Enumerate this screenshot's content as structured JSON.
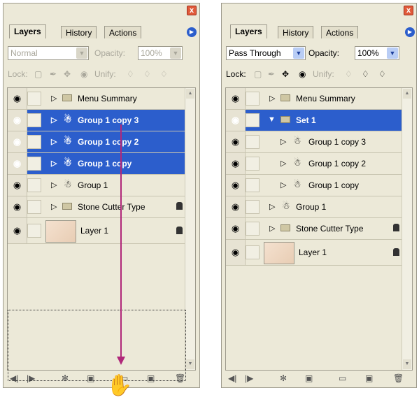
{
  "left_panel": {
    "tabs": [
      "Layers",
      "History",
      "Actions"
    ],
    "blend_mode": "Normal",
    "opacity_label": "Opacity:",
    "opacity_value": "100%",
    "lock_label": "Lock:",
    "unify_label": "Unify:",
    "layers": [
      {
        "name": "Menu Summary",
        "type": "folder",
        "selected": false,
        "locked": false
      },
      {
        "name": "Group 1 copy 3",
        "type": "group",
        "selected": true,
        "locked": false
      },
      {
        "name": "Group 1 copy 2",
        "type": "group",
        "selected": true,
        "locked": false
      },
      {
        "name": "Group 1 copy",
        "type": "group",
        "selected": true,
        "locked": false
      },
      {
        "name": "Group 1",
        "type": "group",
        "selected": false,
        "locked": false
      },
      {
        "name": "Stone Cutter Type",
        "type": "folder",
        "selected": false,
        "locked": true
      },
      {
        "name": "Layer 1",
        "type": "image",
        "selected": false,
        "locked": true
      }
    ]
  },
  "right_panel": {
    "tabs": [
      "Layers",
      "History",
      "Actions"
    ],
    "blend_mode": "Pass Through",
    "opacity_label": "Opacity:",
    "opacity_value": "100%",
    "lock_label": "Lock:",
    "unify_label": "Unify:",
    "layers": [
      {
        "name": "Menu Summary",
        "type": "folder",
        "selected": false,
        "locked": false
      },
      {
        "name": "Set 1",
        "type": "folder-open",
        "selected": true,
        "locked": false
      },
      {
        "name": "Group 1 copy 3",
        "type": "group",
        "selected": false,
        "locked": false,
        "indent": 1
      },
      {
        "name": "Group 1 copy 2",
        "type": "group",
        "selected": false,
        "locked": false,
        "indent": 1
      },
      {
        "name": "Group 1 copy",
        "type": "group",
        "selected": false,
        "locked": false,
        "indent": 1
      },
      {
        "name": "Group 1",
        "type": "group",
        "selected": false,
        "locked": false
      },
      {
        "name": "Stone Cutter Type",
        "type": "folder",
        "selected": false,
        "locked": true
      },
      {
        "name": "Layer 1",
        "type": "image",
        "selected": false,
        "locked": true
      }
    ]
  },
  "colors": {
    "selection": "#2c5ecc",
    "panel_bg": "#ece9d8",
    "drag_arrow": "#b0287a"
  },
  "icons": [
    "eye-icon",
    "brush-icon",
    "move-icon",
    "lock-icon",
    "folder-icon",
    "group-icon",
    "trash-icon",
    "new-layer-icon",
    "new-folder-icon"
  ]
}
